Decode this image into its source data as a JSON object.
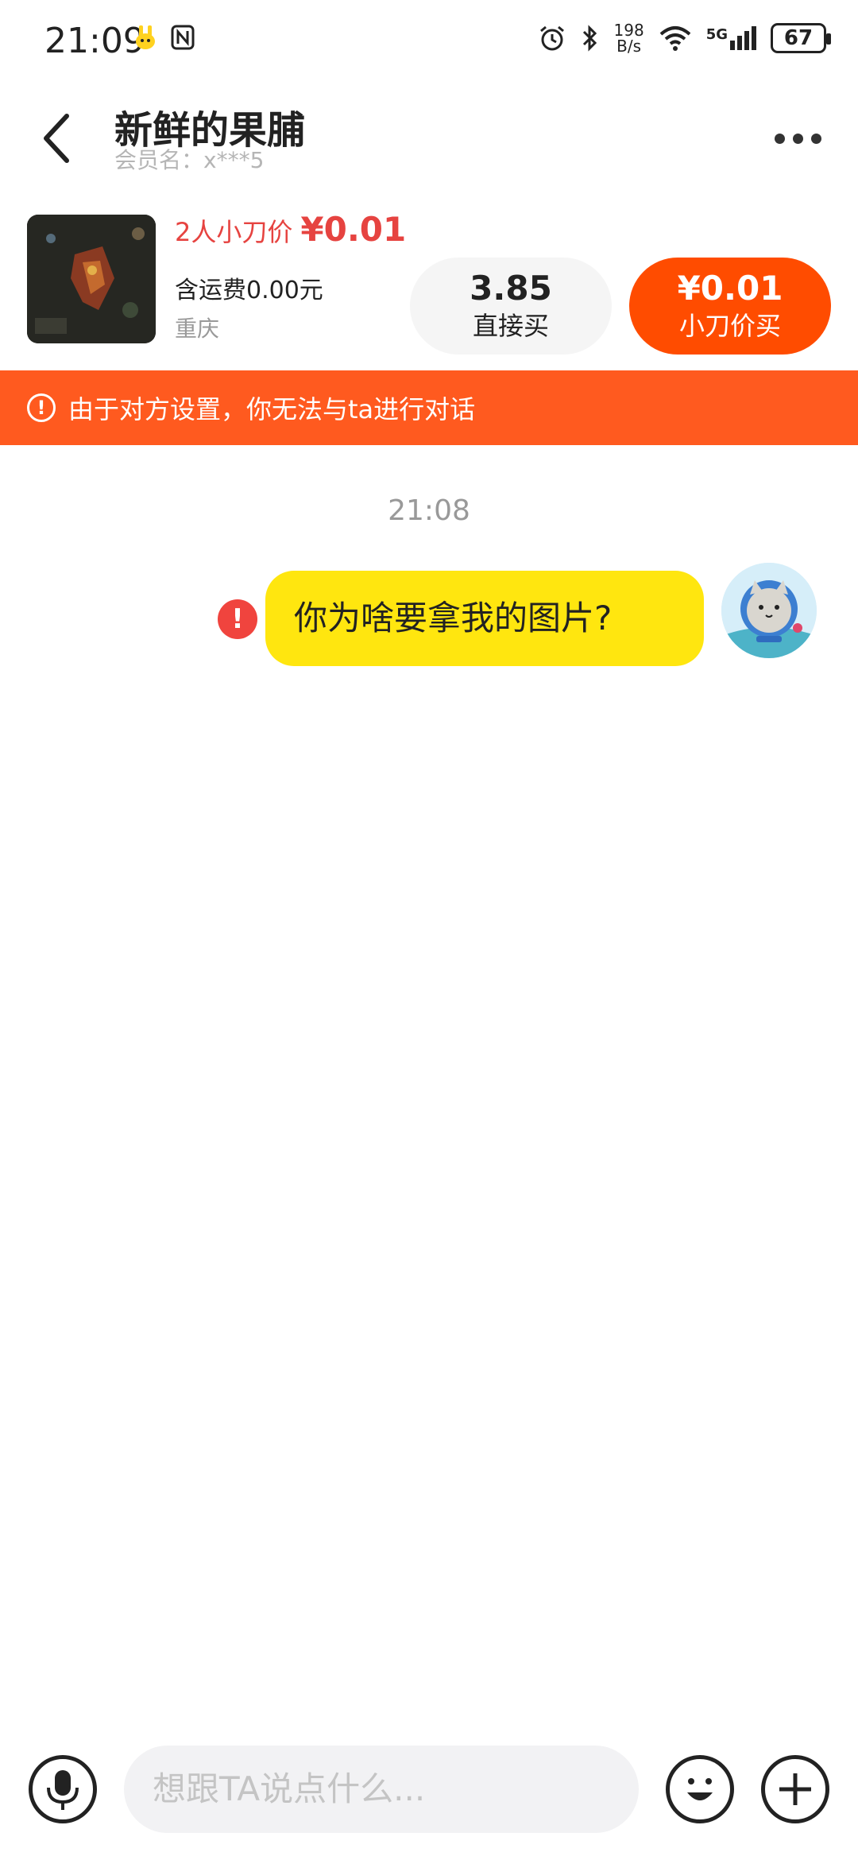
{
  "status_bar": {
    "time": "21:09",
    "net_speed_value": "198",
    "net_speed_unit": "B/s",
    "network": "5G",
    "battery": "67"
  },
  "header": {
    "shop_name": "新鲜的果脯",
    "member_label": "会员名：x***5"
  },
  "product": {
    "deal_label": "2人小刀价",
    "deal_price": "¥0.01",
    "shipping": "含运费0.00元",
    "location": "重庆",
    "direct_price": "3.85",
    "direct_label": "直接买",
    "cut_price": "¥0.01",
    "cut_label": "小刀价买"
  },
  "warning": {
    "icon": "!",
    "text": "由于对方设置，你无法与ta进行对话"
  },
  "chat": {
    "timestamp": "21:08",
    "messages": [
      {
        "text": "你为啥要拿我的图片?",
        "status_icon": "!"
      }
    ]
  },
  "composer": {
    "placeholder": "想跟TA说点什么..."
  },
  "colors": {
    "accent_orange": "#ff4c00",
    "warning_bar": "#ff5a1f",
    "bubble_yellow": "#ffe60f",
    "price_red": "#e64340"
  }
}
